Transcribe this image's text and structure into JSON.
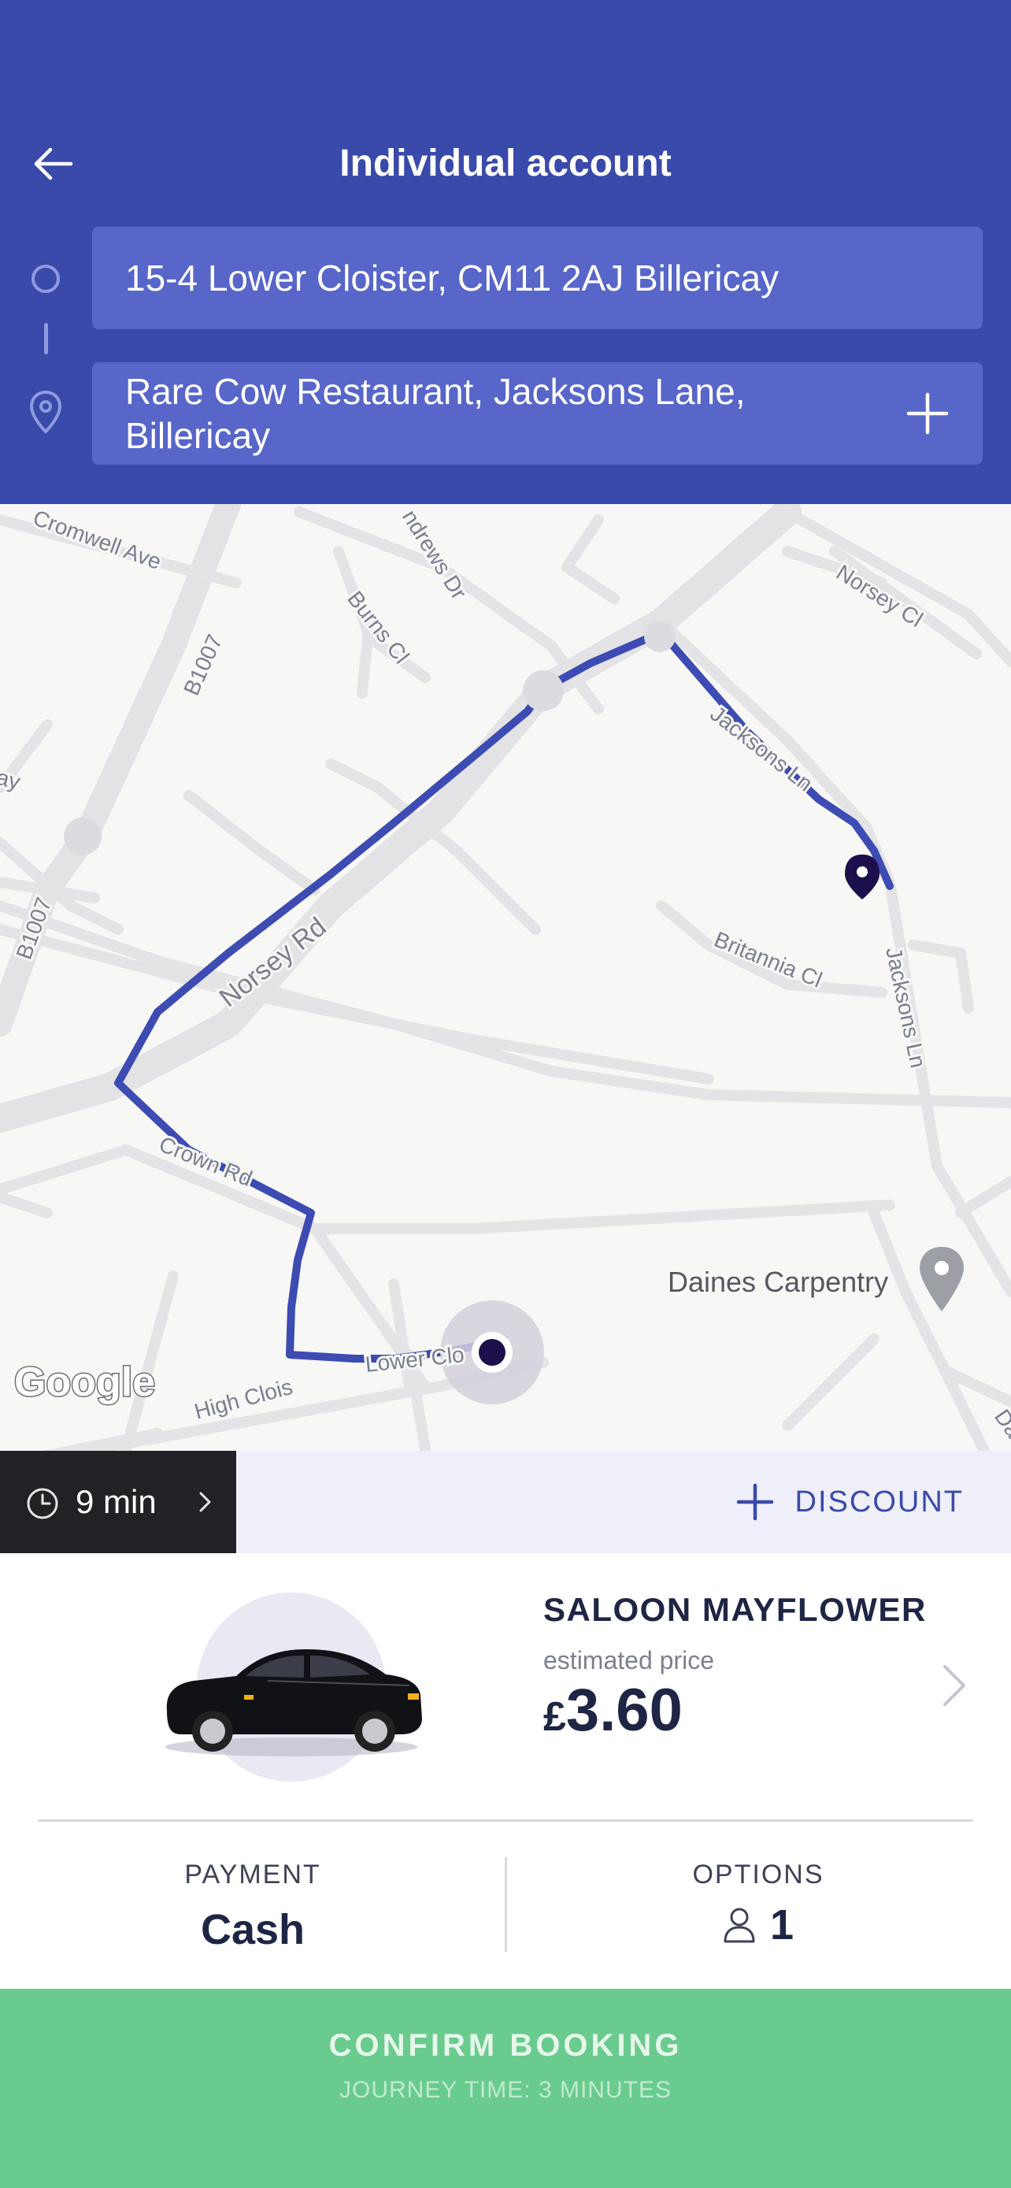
{
  "header": {
    "title": "Individual account",
    "pickup": "15-4 Lower Cloister, CM11 2AJ Billericay",
    "dropoff": "Rare Cow Restaurant, Jacksons Lane, Billericay",
    "accent": "#3a4aaa"
  },
  "map": {
    "streets": [
      "Cromwell Ave",
      "ndrews Dr",
      "Burns Cl",
      "Norsey Cl",
      "B1007",
      "B1007",
      "Jacksons Ln",
      "Britannia Cl",
      "Jacksons Ln",
      "Norsey Rd",
      "Crown Rd",
      "Daines Carpentry",
      "High Clois",
      "Lower Clo",
      "Da",
      "ay"
    ],
    "attribution": "Google",
    "route_color": "#3a4aaa"
  },
  "eta": {
    "label": "9 min"
  },
  "discount": {
    "label": "DISCOUNT"
  },
  "vehicle": {
    "name": "SALOON MAYFLOWER",
    "sub": "estimated price",
    "currency": "£",
    "price": "3.60"
  },
  "payment": {
    "caption": "PAYMENT",
    "value": "Cash"
  },
  "options": {
    "caption": "OPTIONS",
    "passengers": "1"
  },
  "confirm": {
    "label": "CONFIRM BOOKING",
    "sub": "JOURNEY TIME: 3 MINUTES",
    "color": "#6acb8e"
  }
}
